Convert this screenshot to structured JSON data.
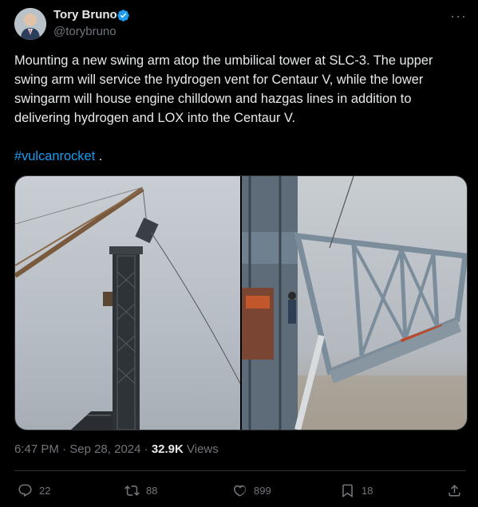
{
  "author": {
    "name": "Tory Bruno",
    "handle": "@torybruno",
    "avatar_icon": "avatar-person",
    "verified_color": "#1d9bf0"
  },
  "tweet": {
    "text": "Mounting a new swing arm atop the umbilical tower at SLC-3. The upper swing arm will service the hydrogen vent for Centaur V, while the lower swingarm will house engine chilldown and hazgas lines in addition to delivering hydrogen and LOX into the Centaur V.",
    "hashtag": "#vulcanrocket",
    "hashtag_suffix": " .",
    "hashtag_color": "#1d9bf0"
  },
  "media": {
    "photo_1_icon": "crane-tower-photo",
    "photo_2_icon": "swing-arm-photo"
  },
  "meta": {
    "time": "6:47 PM",
    "sep1": " · ",
    "date": "Sep 28, 2024",
    "sep2": " · ",
    "views": "32.9K",
    "views_label": " Views"
  },
  "actions": {
    "replies": "22",
    "reposts": "88",
    "likes": "899",
    "bookmarks": "18"
  },
  "more_label": "···"
}
